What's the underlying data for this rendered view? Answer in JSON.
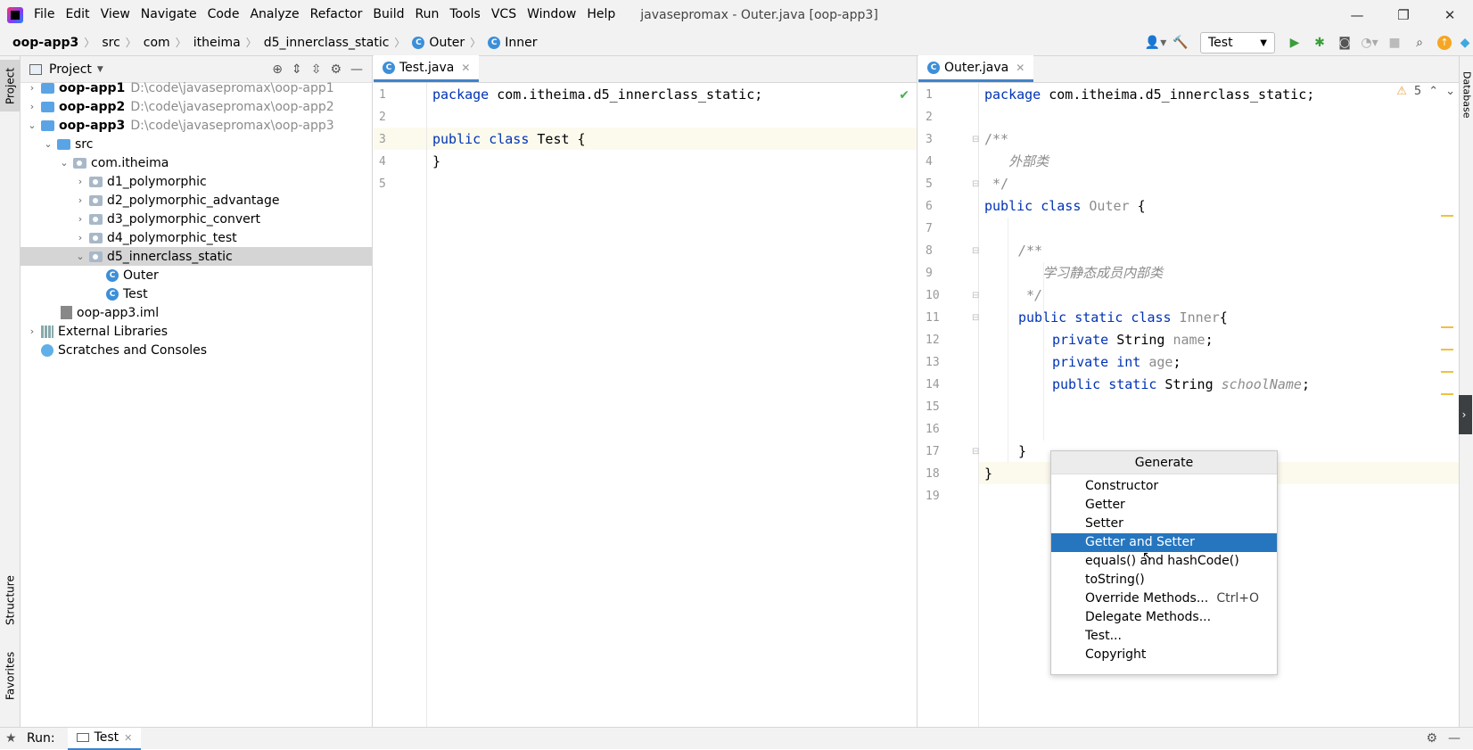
{
  "menu": {
    "items": [
      "File",
      "Edit",
      "View",
      "Navigate",
      "Code",
      "Analyze",
      "Refactor",
      "Build",
      "Run",
      "Tools",
      "VCS",
      "Window",
      "Help"
    ],
    "window_title": "javasepromax - Outer.java [oop-app3]"
  },
  "window_controls": {
    "minimize": "—",
    "restore": "❐",
    "close": "✕"
  },
  "breadcrumb": {
    "items": [
      "oop-app3",
      "src",
      "com",
      "itheima",
      "d5_innerclass_static",
      "Outer",
      "Inner"
    ]
  },
  "toolbar": {
    "run_config": "Test"
  },
  "left_strip": {
    "project_tab": "Project",
    "structure_tab": "Structure",
    "favorites_tab": "Favorites"
  },
  "right_strip": {
    "database_tab": "Database"
  },
  "project_panel": {
    "title": "Project",
    "tree": [
      {
        "label": "oop-app1",
        "path": "D:\\code\\javasepromax\\oop-app1"
      },
      {
        "label": "oop-app2",
        "path": "D:\\code\\javasepromax\\oop-app2"
      },
      {
        "label": "oop-app3",
        "path": "D:\\code\\javasepromax\\oop-app3"
      },
      {
        "label": "src"
      },
      {
        "label": "com.itheima"
      },
      {
        "label": "d1_polymorphic"
      },
      {
        "label": "d2_polymorphic_advantage"
      },
      {
        "label": "d3_polymorphic_convert"
      },
      {
        "label": "d4_polymorphic_test"
      },
      {
        "label": "d5_innerclass_static"
      },
      {
        "label": "Outer"
      },
      {
        "label": "Test"
      },
      {
        "label": "oop-app3.iml"
      },
      {
        "label": "External Libraries"
      },
      {
        "label": "Scratches and Consoles"
      }
    ]
  },
  "left_editor": {
    "tab": "Test.java",
    "line_numbers": [
      "1",
      "2",
      "3",
      "4",
      "5"
    ],
    "code": {
      "l1_kw": "package",
      "l1_rest": " com.itheima.d5_innerclass_static;",
      "l3_kw": "public class",
      "l3_rest": " Test {",
      "l4": "}"
    }
  },
  "right_editor": {
    "tab": "Outer.java",
    "warning_count": "5",
    "line_numbers": [
      "1",
      "2",
      "3",
      "4",
      "5",
      "6",
      "7",
      "8",
      "9",
      "10",
      "11",
      "12",
      "13",
      "14",
      "15",
      "16",
      "17",
      "18",
      "19"
    ],
    "code": {
      "l1_kw": "package",
      "l1_rest": " com.itheima.d5_innerclass_static;",
      "l3": "/**",
      "l4": "   外部类",
      "l5": " */",
      "l6_kw": "public class",
      "l6_name": " Outer",
      "l6_rest": " {",
      "l8": "/**",
      "l9": "   学习静态成员内部类",
      "l10": " */",
      "l11_kw": "public static class",
      "l11_name": " Inner",
      "l11_rest": "{",
      "l12_kw": "private",
      "l12_type": " String ",
      "l12_name": "name",
      "l12_end": ";",
      "l13_kw": "private int",
      "l13_name": " age",
      "l13_end": ";",
      "l14_kw": "public static",
      "l14_type": " String ",
      "l14_name": "schoolName",
      "l14_end": ";",
      "l17": "}",
      "l18": "}"
    }
  },
  "generate_popup": {
    "title": "Generate",
    "items": [
      {
        "label": "Constructor",
        "shortcut": ""
      },
      {
        "label": "Getter",
        "shortcut": ""
      },
      {
        "label": "Setter",
        "shortcut": ""
      },
      {
        "label": "Getter and Setter",
        "shortcut": ""
      },
      {
        "label": "equals() and hashCode()",
        "shortcut": ""
      },
      {
        "label": "toString()",
        "shortcut": ""
      },
      {
        "label": "Override Methods...",
        "shortcut": "Ctrl+O"
      },
      {
        "label": "Delegate Methods...",
        "shortcut": ""
      },
      {
        "label": "Test...",
        "shortcut": ""
      },
      {
        "label": "Copyright",
        "shortcut": ""
      }
    ],
    "selected": "Getter and Setter"
  },
  "run_bar": {
    "label": "Run:",
    "tab": "Test"
  },
  "colors": {
    "accent": "#2675bf",
    "keyword": "#0033b3",
    "field": "#871094",
    "comment": "#8c8c8c",
    "selection": "#d5d5d5"
  }
}
